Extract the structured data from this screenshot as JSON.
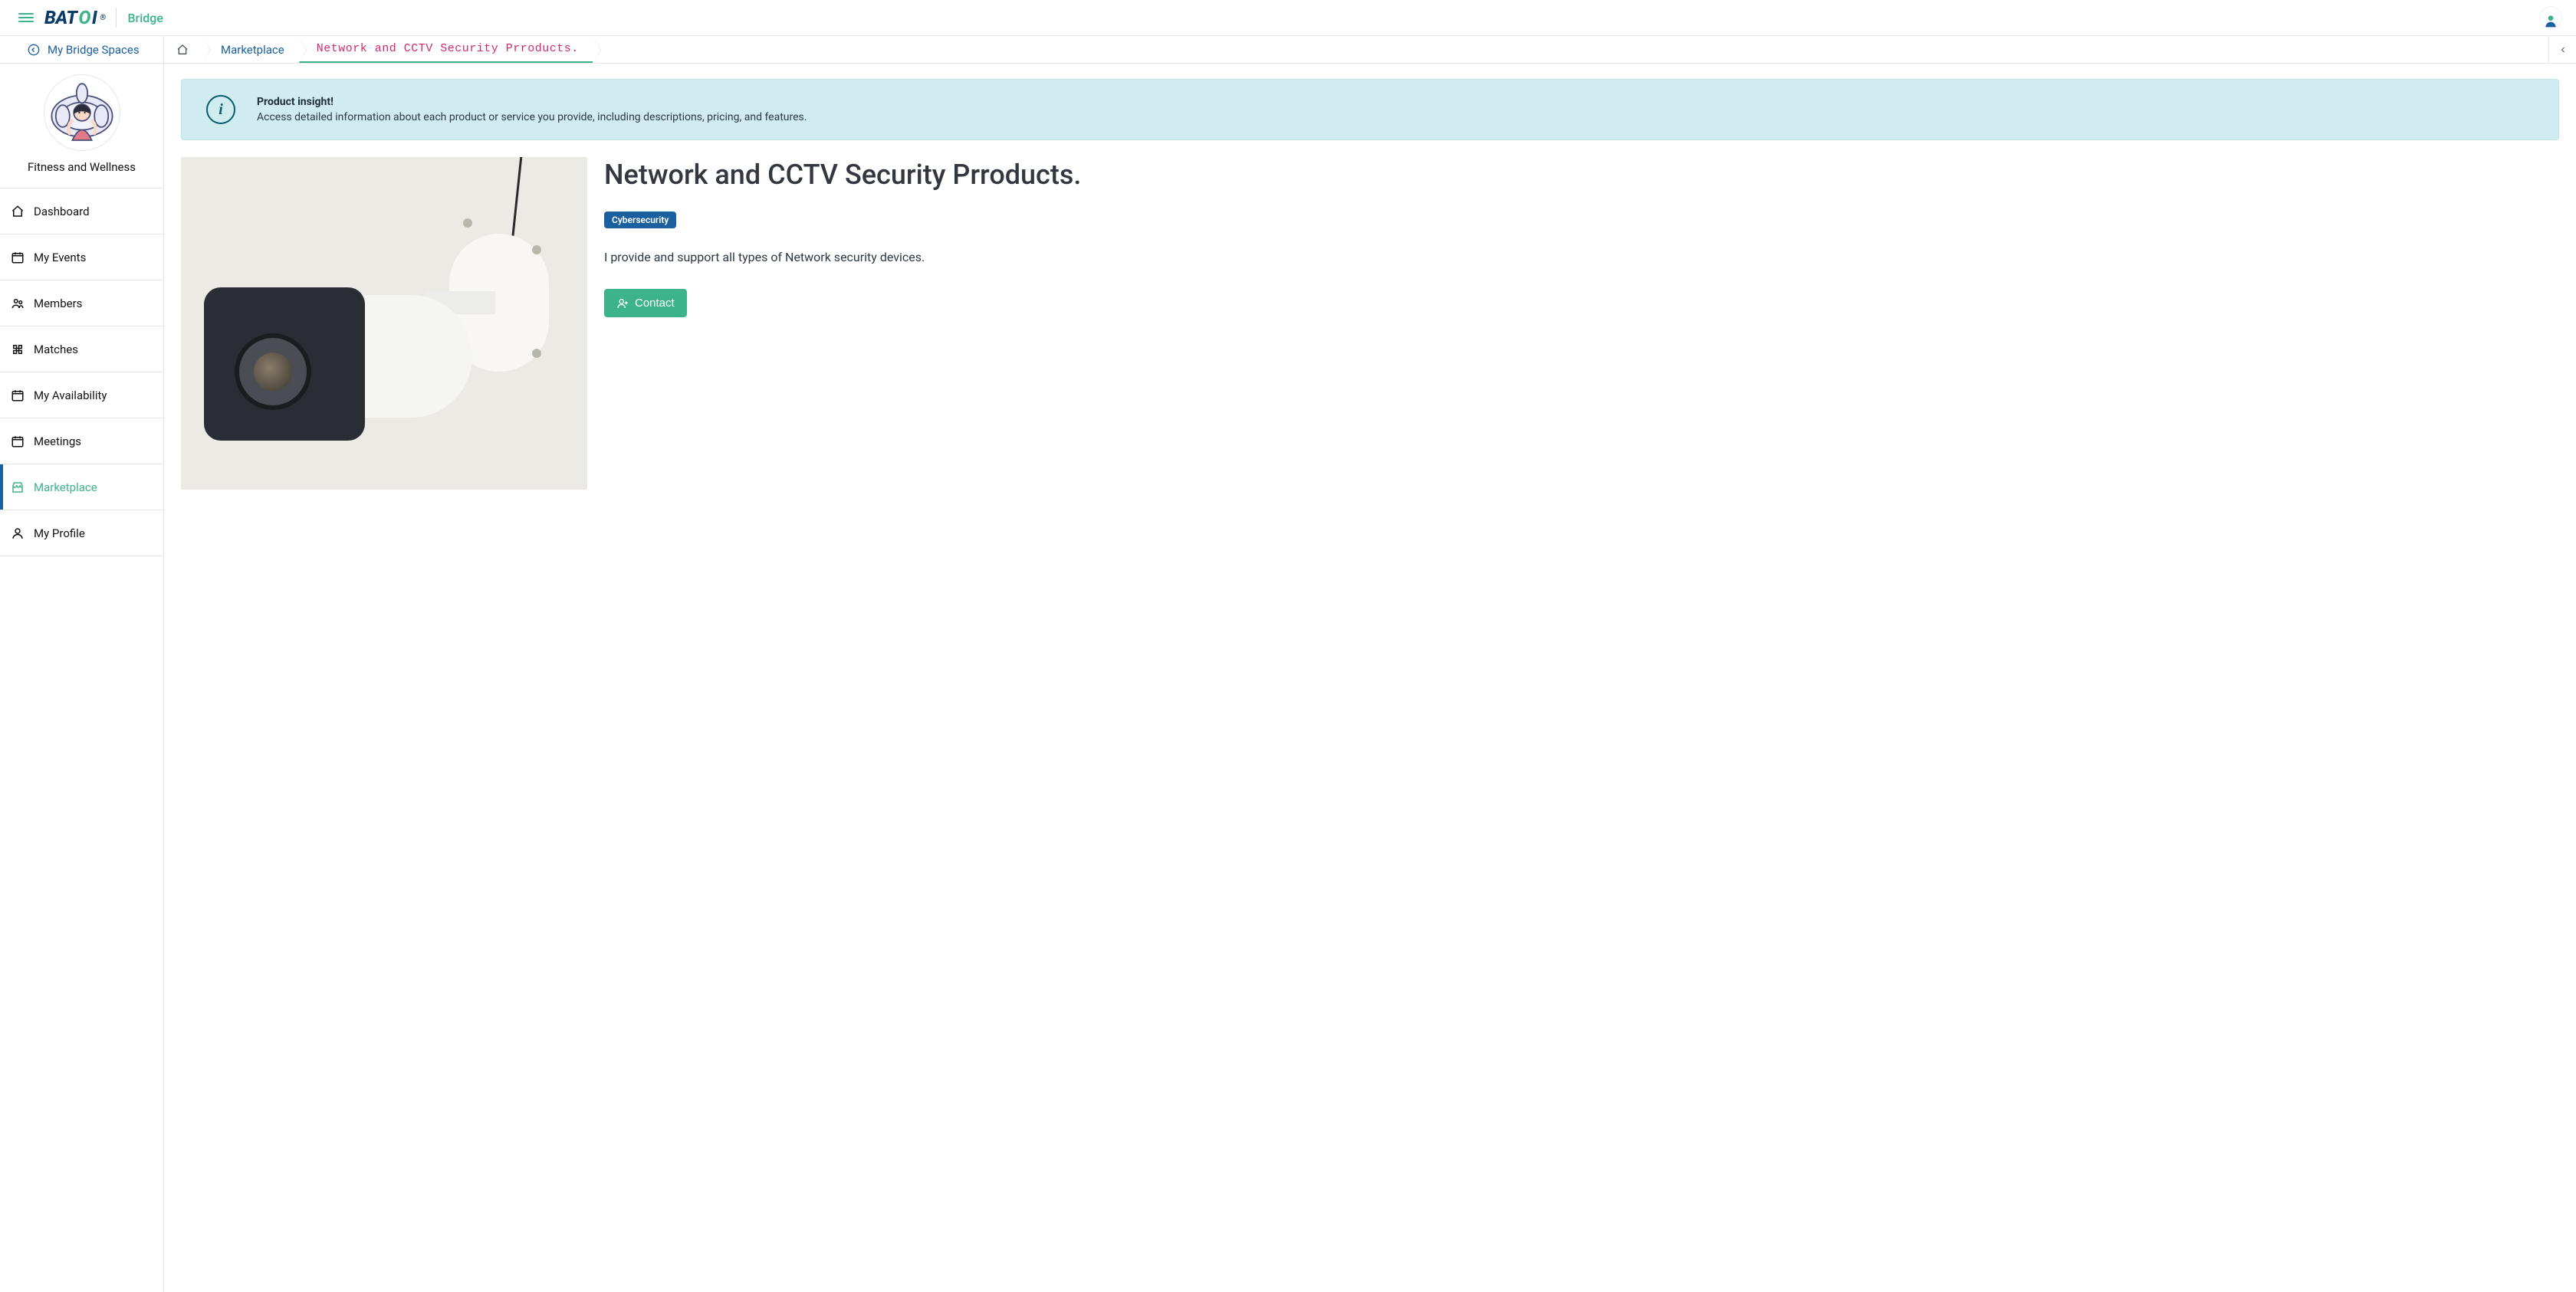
{
  "header": {
    "brand_primary": "BATOI",
    "brand_sub": "Bridge"
  },
  "breadcrumb": {
    "back_label": "My Bridge Spaces",
    "marketplace": "Marketplace",
    "current": "Network and CCTV Security Prroducts."
  },
  "sidebar": {
    "space_name": "Fitness and Wellness",
    "items": [
      {
        "label": "Dashboard"
      },
      {
        "label": "My Events"
      },
      {
        "label": "Members"
      },
      {
        "label": "Matches"
      },
      {
        "label": "My Availability"
      },
      {
        "label": "Meetings"
      },
      {
        "label": "Marketplace"
      },
      {
        "label": "My Profile"
      }
    ]
  },
  "banner": {
    "title": "Product insight!",
    "desc": "Access detailed information about each product or service you provide, including descriptions, pricing, and features."
  },
  "product": {
    "title": "Network and CCTV Security Prroducts.",
    "tag": "Cybersecurity",
    "description": "I provide and support all types of Network security devices.",
    "contact_label": "Contact"
  }
}
